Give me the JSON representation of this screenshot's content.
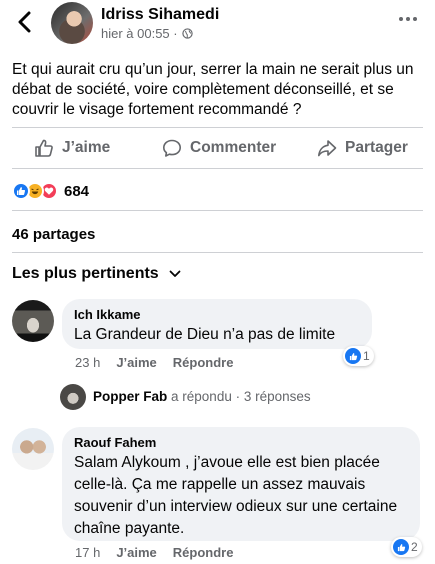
{
  "header": {
    "author": "Idriss Sihamedi",
    "timestamp": "hier à 00:55 ·",
    "privacy_icon": "globe-icon",
    "back_icon": "chevron-left-icon",
    "more_icon": "more-horizontal-icon"
  },
  "post": {
    "text": "Et qui aurait cru qu’un jour, serrer la main ne serait plus un débat de société, voire complètement déconseillé, et se couvrir le visage fortement recommandé ?"
  },
  "actions": {
    "like": "J’aime",
    "comment": "Commenter",
    "share": "Partager"
  },
  "reactions": {
    "types": [
      "like",
      "haha",
      "love"
    ],
    "count": "684"
  },
  "shares": "46 partages",
  "sort_label": "Les plus pertinents",
  "comments": [
    {
      "author": "Ich Ikkame",
      "text": "La Grandeur de Dieu n’a pas de limite",
      "time": "23 h",
      "like_label": "J’aime",
      "reply_label": "Répondre",
      "reaction_count": "1"
    },
    {
      "author": "Raouf Fahem",
      "text": "Salam Alykoum , j’avoue elle est bien placée celle-là. Ça me rappelle un assez mauvais souvenir d’un interview odieux sur une certaine chaîne payante.",
      "time": "17 h",
      "like_label": "J’aime",
      "reply_label": "Répondre",
      "reaction_count": "2"
    }
  ],
  "reply_summary": {
    "name": "Popper Fab",
    "text": "a répondu · 3 réponses"
  },
  "colors": {
    "accent": "#1877f2",
    "secondary_text": "#65676b",
    "bubble": "#f0f2f5",
    "haha": "#f7b125",
    "love": "#f33e58"
  }
}
